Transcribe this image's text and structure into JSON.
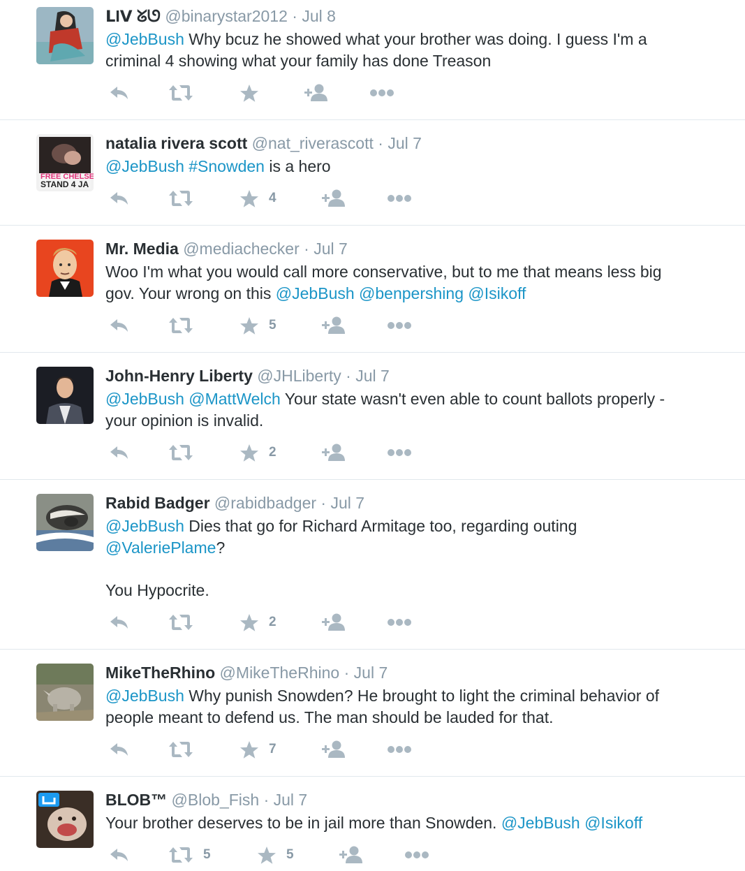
{
  "colors": {
    "link": "#1b95c7",
    "icon": "#aab8c2",
    "meta": "#8899a6",
    "divider": "#e1e8ed"
  },
  "icons": {
    "reply": "reply-icon",
    "retweet": "retweet-icon",
    "favorite": "star-icon",
    "follow": "follow-icon",
    "more": "more-icon"
  },
  "tweets": [
    {
      "name": "ᒪIᐯ ᘜᘎ",
      "handle": "@binarystar2012",
      "time": "Jul 8",
      "lines": [
        [
          {
            "t": "@JebBush",
            "l": true
          },
          {
            "t": " Why bcuz he showed what your brother was doing. I guess I'm a"
          }
        ],
        [
          {
            "t": "criminal 4 showing what your family has done Treason"
          }
        ]
      ],
      "retweets": "",
      "favorites": ""
    },
    {
      "name": "natalia rivera scott",
      "handle": "@nat_riverascott",
      "time": "Jul 7",
      "lines": [
        [
          {
            "t": "@JebBush",
            "l": true
          },
          {
            "t": " "
          },
          {
            "t": "#Snowden",
            "l": true
          },
          {
            "t": " is a hero"
          }
        ]
      ],
      "retweets": "",
      "favorites": "4",
      "avatar_text": "STAND 4 JA",
      "avatar_text2": "FREE CHELSEA"
    },
    {
      "name": "Mr. Media",
      "handle": "@mediachecker",
      "time": "Jul 7",
      "lines": [
        [
          {
            "t": "Woo I'm what you would call more conservative, but to me that means less big"
          }
        ],
        [
          {
            "t": "gov. Your wrong on this "
          },
          {
            "t": "@JebBush",
            "l": true
          },
          {
            "t": " "
          },
          {
            "t": "@benpershing",
            "l": true
          },
          {
            "t": " "
          },
          {
            "t": "@Isikoff",
            "l": true
          }
        ]
      ],
      "retweets": "",
      "favorites": "5"
    },
    {
      "name": "John-Henry Liberty",
      "handle": "@JHLiberty",
      "time": "Jul 7",
      "lines": [
        [
          {
            "t": "@JebBush",
            "l": true
          },
          {
            "t": " "
          },
          {
            "t": "@MattWelch",
            "l": true
          },
          {
            "t": " Your state wasn't even able to count ballots properly -"
          }
        ],
        [
          {
            "t": "your opinion is invalid."
          }
        ]
      ],
      "retweets": "",
      "favorites": "2"
    },
    {
      "name": "Rabid Badger",
      "handle": "@rabidbadger",
      "time": "Jul 7",
      "lines": [
        [
          {
            "t": "@JebBush",
            "l": true
          },
          {
            "t": " Dies that go for Richard Armitage too, regarding outing"
          }
        ],
        [
          {
            "t": "@ValeriePlame",
            "l": true
          },
          {
            "t": "?"
          }
        ],
        [],
        [
          {
            "t": "You Hypocrite."
          }
        ]
      ],
      "retweets": "",
      "favorites": "2"
    },
    {
      "name": "MikeTheRhino",
      "handle": "@MikeTheRhino",
      "time": "Jul 7",
      "lines": [
        [
          {
            "t": "@JebBush",
            "l": true
          },
          {
            "t": " Why punish Snowden? He brought to light the criminal behavior of"
          }
        ],
        [
          {
            "t": "people meant to defend us.  The man should be lauded for that."
          }
        ]
      ],
      "retweets": "",
      "favorites": "7"
    },
    {
      "name": "BLOB™",
      "handle": "@Blob_Fish",
      "time": "Jul 7",
      "lines": [
        [
          {
            "t": "Your brother deserves to be in jail more than Snowden. "
          },
          {
            "t": "@JebBush",
            "l": true
          },
          {
            "t": " "
          },
          {
            "t": "@Isikoff",
            "l": true
          }
        ]
      ],
      "retweets": "5",
      "favorites": "5"
    }
  ]
}
